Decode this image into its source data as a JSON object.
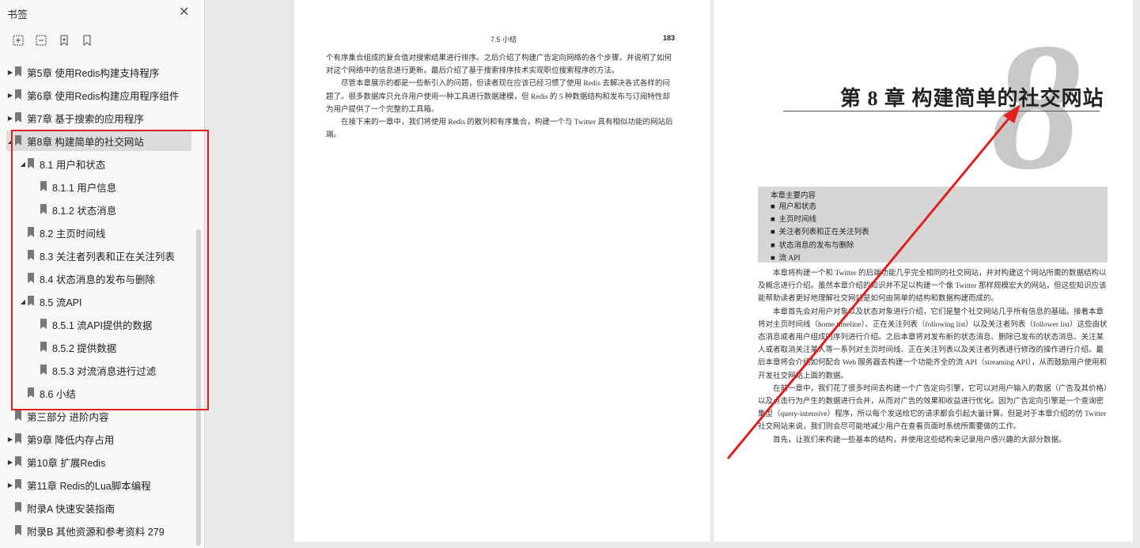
{
  "sidebar": {
    "title": "书签",
    "close_label": "✕",
    "tools": [
      "expand-all-icon",
      "collapse-all-icon",
      "add-bookmark-icon",
      "bookmark-icon"
    ],
    "items": [
      {
        "label": "第5章  使用Redis构建支持程序",
        "expandable": true,
        "expanded": false
      },
      {
        "label": "第6章  使用Redis构建应用程序组件",
        "expandable": true,
        "expanded": false
      },
      {
        "label": "第7章  基于搜索的应用程序",
        "expandable": true,
        "expanded": false
      },
      {
        "label": "第8章  构建简单的社交网站",
        "expandable": true,
        "expanded": true,
        "selected": true
      },
      {
        "label": "8.1  用户和状态",
        "expandable": true,
        "expanded": true
      },
      {
        "label": "8.1.1  用户信息",
        "expandable": false
      },
      {
        "label": "8.1.2  状态消息",
        "expandable": false
      },
      {
        "label": "8.2  主页时间线",
        "expandable": false
      },
      {
        "label": "8.3  关注者列表和正在关注列表",
        "expandable": false
      },
      {
        "label": "8.4  状态消息的发布与删除",
        "expandable": false
      },
      {
        "label": "8.5  流API",
        "expandable": true,
        "expanded": true
      },
      {
        "label": "8.5.1  流API提供的数据",
        "expandable": false
      },
      {
        "label": "8.5.2  提供数据",
        "expandable": false
      },
      {
        "label": "8.5.3  对流消息进行过滤",
        "expandable": false
      },
      {
        "label": "8.6  小结",
        "expandable": false
      },
      {
        "label": "第三部分    进阶内容",
        "expandable": false
      },
      {
        "label": "第9章  降低内存占用",
        "expandable": true,
        "expanded": false
      },
      {
        "label": "第10章  扩展Redis",
        "expandable": true,
        "expanded": false
      },
      {
        "label": "第11章  Redis的Lua脚本编程",
        "expandable": true,
        "expanded": false
      },
      {
        "label": "附录A    快速安装指南",
        "expandable": false
      },
      {
        "label": "附录B    其他资源和参考资料    279",
        "expandable": false
      }
    ]
  },
  "left_page": {
    "header": "7.5    小结",
    "page_number": "183",
    "paragraphs": [
      "个有序集合组成的复合值对搜索结果进行排序。之后介绍了构建广告定向网络的各个步骤，并说明了如何对这个网络中的信息进行更新。最后介绍了基于搜索排序技术实现职位搜索程序的方法。",
      "尽管本章展示的都是一些新引入的问题，但读者现在应该已经习惯了使用 Redis 去解决各式各样的问题了。很多数据库只允许用户使用一种工具进行数据建模，但 Redis 的 5 种数据结构和发布与订阅特性却为用户提供了一个完整的工具箱。",
      "在接下来的一章中，我们将使用 Redis 的散列和有序集合，构建一个与 Twitter 具有相似功能的网站后端。"
    ]
  },
  "right_page": {
    "big_number": "8",
    "chapter_title": "第 8 章    构建简单的社交网站",
    "summary_heading": "本章主要内容",
    "summary_items": [
      "用户和状态",
      "主页时间线",
      "关注者列表和正在关注列表",
      "状态消息的发布与删除",
      "流 API"
    ],
    "bullet": "■",
    "paragraphs": [
      "本章将构建一个和 Twitter 的后端功能几乎完全相同的社交网站，并对构建这个网站所需的数据结构以及概念进行介绍。虽然本章介绍的知识并不足以构建一个像 Twitter 那样规模宏大的网站，但这些知识应该能帮助读者更好地理解社交网站是如何由简单的结构和数据构建而成的。",
      "本章首先会对用户对象以及状态对象进行介绍，它们是整个社交网站几乎所有信息的基础。接着本章将对主页时间线（home timeline）、正在关注列表（following list）以及关注者列表（follower list）这些由状态消息或者用户组成的序列进行介绍。之后本章将对发布新的状态消息、删除已发布的状态消息、关注某人或者取消关注某人等一系列对主页时间线、正在关注列表以及关注者列表进行修改的操作进行介绍。最后本章将会介绍如何配合 Web 服务器去构建一个功能齐全的流 API（streaming API），从而鼓励用户使用和开发社交网站上面的数据。",
      "在前一章中，我们花了很多时间去构建一个广告定向引擎，它可以对用户输入的数据（广告及其价格）以及点击行为产生的数据进行合并，从而对广告的效果和收益进行优化。因为广告定向引擎是一个查询密集型（query-intensive）程序，所以每个发送给它的请求都会引起大量计算。但是对于本章介绍的仿 Twitter 社交网站来说，我们则会尽可能地减少用户在查看页面时系统所需要做的工作。",
      "首先，让我们来构建一些基本的结构，并使用这些结构来记录用户感兴趣的大部分数据。"
    ]
  },
  "annotation_color": "#e02020"
}
